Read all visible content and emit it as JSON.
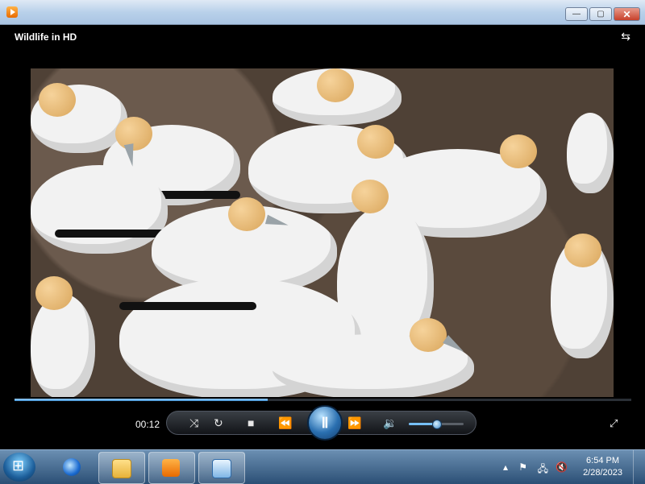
{
  "window": {
    "video_title": "Wildlife in HD",
    "buttons": {
      "minimize_icon": "minimize-icon",
      "maximize_icon": "maximize-icon",
      "close_icon": "close-icon"
    }
  },
  "player": {
    "time": "00:12",
    "progress_fraction": 0.41,
    "volume_fraction": 0.5,
    "controls": {
      "shuffle_icon": "shuffle-icon",
      "repeat_icon": "repeat-icon",
      "stop_icon": "stop-icon",
      "previous_icon": "previous-icon",
      "pause_icon": "pause-icon",
      "next_icon": "next-icon",
      "volume_icon": "volume-icon",
      "fullscreen_icon": "fullscreen-icon",
      "switch_to_library_icon": "switch-to-library-icon"
    }
  },
  "taskbar": {
    "clock_time": "6:54 PM",
    "clock_date": "2/28/2023",
    "apps": [
      "start-orb",
      "internet-explorer",
      "file-explorer",
      "windows-media-player",
      "control-panel"
    ]
  },
  "colors": {
    "accent": "#3e8fd1",
    "taskbar": "#2b4f75",
    "titlebar": "#b9d1ea"
  }
}
